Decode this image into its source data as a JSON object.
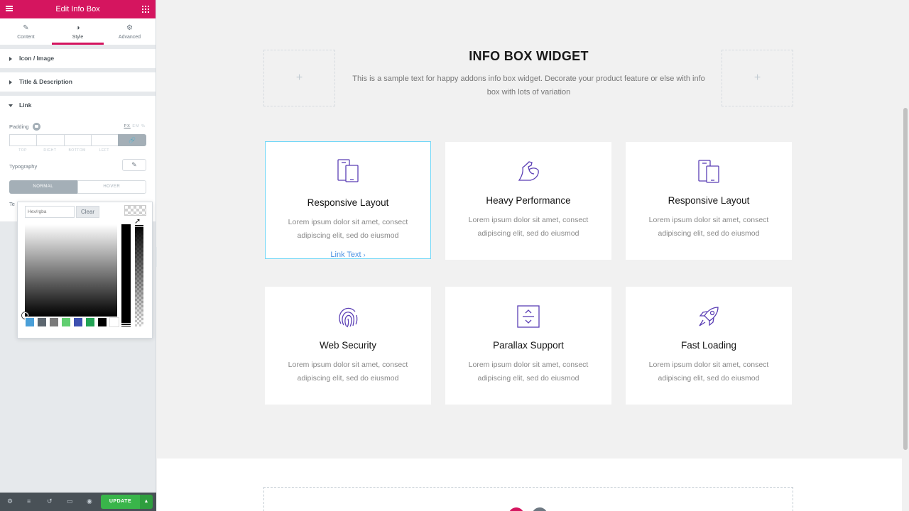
{
  "panel": {
    "header_title": "Edit Info Box",
    "tabs": [
      {
        "label": "Content",
        "icon": "pencil-icon"
      },
      {
        "label": "Style",
        "icon": "half-circle-icon"
      },
      {
        "label": "Advanced",
        "icon": "gear-icon"
      }
    ],
    "sections": {
      "icon_image": "Icon / Image",
      "title_desc": "Title & Description",
      "link": "Link"
    },
    "padding_label": "Padding",
    "units": {
      "px": "PX",
      "em": "EM",
      "pct": "%"
    },
    "dim_labels": {
      "top": "TOP",
      "right": "RIGHT",
      "bottom": "BOTTOM",
      "left": "LEFT"
    },
    "typography_label": "Typography",
    "normal_label": "NORMAL",
    "hover_label": "HOVER",
    "text_color_label": "Te",
    "update_label": "UPDATE"
  },
  "color_picker": {
    "hex_placeholder": "Hex/rgba",
    "clear_label": "Clear",
    "palette": [
      "#4a9fd8",
      "#5d6770",
      "#7a7a7a",
      "#61ce70",
      "#3d50b0",
      "#23a455",
      "#000000",
      "#ffffff"
    ]
  },
  "preview": {
    "heading": {
      "title": "INFO BOX WIDGET",
      "description": "This is a sample text for happy addons info box widget. Decorate your product feature or else with info box with lots of variation"
    },
    "cards": [
      {
        "icon": "mobile-tablet-icon",
        "title": "Responsive Layout",
        "desc": "Lorem ipsum dolor sit amet, consect adipiscing elit, sed do eiusmod",
        "link": "Link Text"
      },
      {
        "icon": "flexed-arm-icon",
        "title": "Heavy Performance",
        "desc": "Lorem ipsum dolor sit amet, consect adipiscing elit, sed do eiusmod"
      },
      {
        "icon": "mobile-tablet-icon",
        "title": "Responsive Layout",
        "desc": "Lorem ipsum dolor sit amet, consect adipiscing elit, sed do eiusmod"
      },
      {
        "icon": "fingerprint-icon",
        "title": "Web Security",
        "desc": "Lorem ipsum dolor sit amet, consect adipiscing elit, sed do eiusmod"
      },
      {
        "icon": "parallax-icon",
        "title": "Parallax Support",
        "desc": "Lorem ipsum dolor sit amet, consect adipiscing elit, sed do eiusmod"
      },
      {
        "icon": "rocket-icon",
        "title": "Fast Loading",
        "desc": "Lorem ipsum dolor sit amet, consect adipiscing elit, sed do eiusmod"
      }
    ]
  },
  "colors": {
    "brand": "#d5155f",
    "icon_purple": "#5b3fb5",
    "link_blue": "#4a90e2",
    "update_green": "#39b54a"
  }
}
